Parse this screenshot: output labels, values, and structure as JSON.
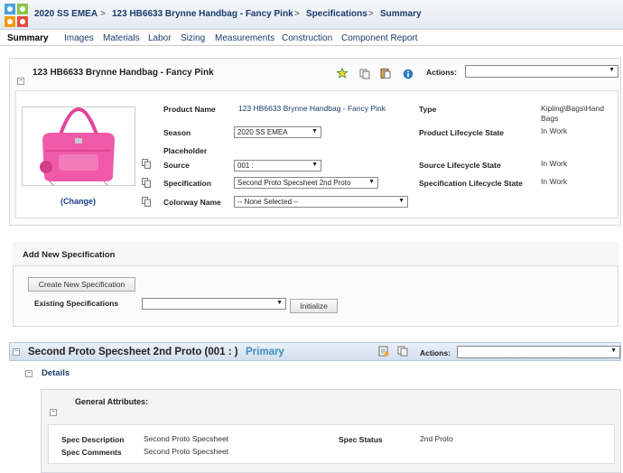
{
  "breadcrumb": {
    "season": "2020 SS EMEA",
    "product": "123 HB6633 Brynne Handbag - Fancy Pink",
    "specifications": "Specifications",
    "summary": "Summary",
    "separator": ">"
  },
  "tabs": [
    "Summary",
    "Images",
    "Materials",
    "Labor",
    "Sizing",
    "Measurements",
    "Construction",
    "Component Report"
  ],
  "product_panel": {
    "title": "123 HB6633 Brynne Handbag - Fancy Pink",
    "actions_label": "Actions:",
    "actions_value": "",
    "change_link": "(Change)",
    "fields": {
      "product_name_label": "Product Name",
      "product_name_value": "123 HB6633 Brynne Handbag - Fancy Pink",
      "season_label": "Season",
      "season_value": "2020 SS EMEA",
      "placeholder_label": "Placeholder",
      "source_label": "Source",
      "source_value": "001 :",
      "specification_label": "Specification",
      "specification_value": "Second Proto Specsheet 2nd Proto",
      "colorway_label": "Colorway Name",
      "colorway_value": "-- None Selected --",
      "type_label": "Type",
      "type_value_line1": "Kipling\\Bags\\Hand",
      "type_value_line2": "Bags",
      "lifecycle_label": "Product Lifecycle State",
      "lifecycle_value": "In Work",
      "source_lifecycle_label": "Source Lifecycle State",
      "source_lifecycle_value": "In Work",
      "spec_lifecycle_label": "Specification Lifecycle State",
      "spec_lifecycle_value": "In Work"
    }
  },
  "add_spec": {
    "title": "Add New Specification",
    "create_button": "Create New Specification",
    "existing_label": "Existing Specifications",
    "existing_value": "",
    "initialize_button": "Initialize"
  },
  "spec_section": {
    "title": "Second Proto Specsheet 2nd Proto (001 : )",
    "primary": "Primary",
    "actions_label": "Actions:",
    "details_label": "Details",
    "general_attributes": "General Attributes:",
    "spec_description_label": "Spec Description",
    "spec_description_value": "Second Proto Specsheet",
    "spec_comments_label": "Spec Comments",
    "spec_comments_value": "Second Proto Specsheet",
    "spec_status_label": "Spec Status",
    "spec_status_value": "2nd Proto"
  },
  "colors": {
    "accent": "#1a3a6b",
    "bag_pink": "#f05aa8",
    "primary_text": "#3a8fc0"
  }
}
